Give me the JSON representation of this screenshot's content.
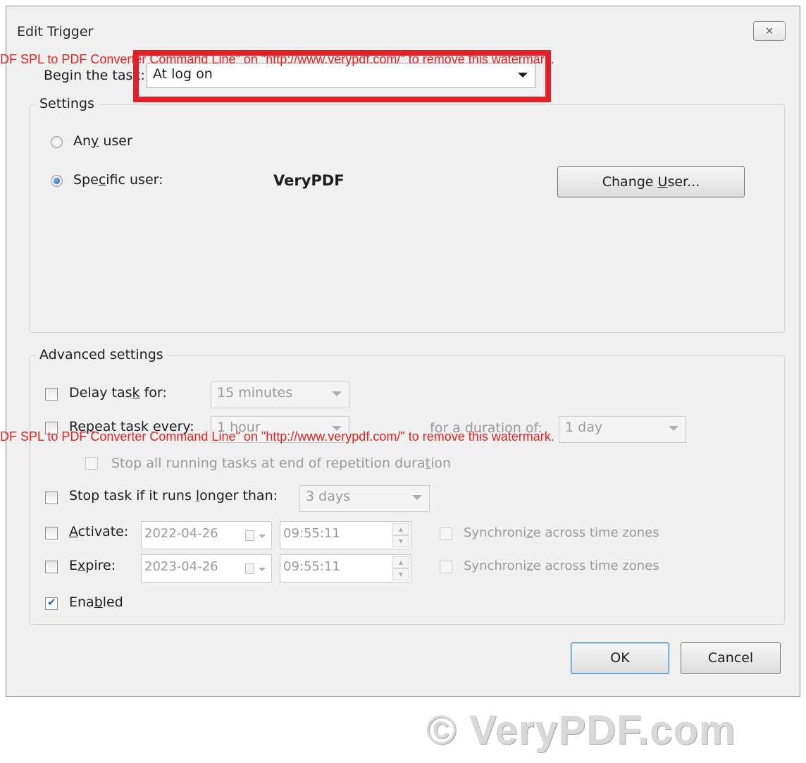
{
  "window": {
    "title": "Edit Trigger",
    "close_glyph": "✕"
  },
  "begin": {
    "label_pre": "Be",
    "label_key": "g",
    "label_post": "in the task:",
    "value": "At log on"
  },
  "settings": {
    "title": "Settings",
    "any_user_pre": "An",
    "any_user_key": "y",
    "any_user_post": " user",
    "specific_user_pre": "Spe",
    "specific_user_key": "c",
    "specific_user_post": "ific user:",
    "user_name": "VeryPDF",
    "change_user_pre": "Change ",
    "change_user_key": "U",
    "change_user_post": "ser...",
    "selected": "specific"
  },
  "advanced": {
    "title": "Advanced settings",
    "delay": {
      "pre": "Delay tas",
      "key": "k",
      "post": " for:",
      "value": "15 minutes",
      "checked": false
    },
    "repeat": {
      "pre": "Re",
      "key": "p",
      "post": "eat task every:",
      "value": "1 hour",
      "duration_label": "for a duration of:",
      "duration_value": "1 day",
      "checked": false
    },
    "stop_running": {
      "pre": "Stop all running tasks at end of repetition dura",
      "key": "t",
      "post": "ion",
      "checked": false
    },
    "stop_longer": {
      "pre": "Stop task if it runs ",
      "key": "l",
      "post": "onger than:",
      "value": "3 days",
      "checked": false
    },
    "activate": {
      "pre": "",
      "key": "A",
      "post": "ctivate:",
      "date": "2022-04-26",
      "time": "09:55:11",
      "sync_pre": "Synchroni",
      "sync_key": "z",
      "sync_post": "e across time zones",
      "checked": false
    },
    "expire": {
      "pre": "E",
      "key": "x",
      "post": "pire:",
      "date": "2023-04-26",
      "time": "09:55:11",
      "sync_pre": "Synchroni",
      "sync_key": "z",
      "sync_post": "e across time zones",
      "checked": false
    },
    "enabled": {
      "pre": "Ena",
      "key": "b",
      "post": "led",
      "checked": true
    }
  },
  "buttons": {
    "ok": "OK",
    "cancel": "Cancel"
  },
  "watermark": "DF SPL to PDF Converter Command Line\" on \"http://www.verypdf.com/\" to remove this watermark.",
  "footer_logo": "© VeryPDF.com",
  "colors": {
    "highlight": "#e32028",
    "watermark": "#e0231f"
  }
}
